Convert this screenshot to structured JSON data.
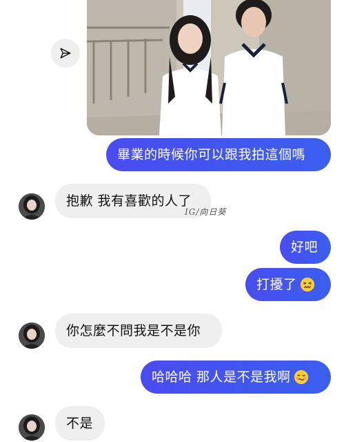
{
  "messages": [
    {
      "id": "m1",
      "text": "畢業的時候你可以跟我拍這個嗎"
    },
    {
      "id": "m2",
      "text": "抱歉 我有喜歡的人了"
    },
    {
      "id": "m3",
      "text": "好吧"
    },
    {
      "id": "m4",
      "text": "打擾了"
    },
    {
      "id": "m5",
      "text": "你怎麼不問我是不是你"
    },
    {
      "id": "m6",
      "text": "哈哈哈 那人是不是我啊"
    },
    {
      "id": "m7",
      "text": "不是"
    }
  ],
  "watermark": "IG/向日葵",
  "icons": {
    "share": "paper-plane-icon",
    "emoji_confounded": "confounded-face-emoji",
    "emoji_woozy": "woozy-face-emoji"
  },
  "colors": {
    "outgoing_bubble": "#3b5cf0",
    "incoming_bubble": "#efefef"
  }
}
